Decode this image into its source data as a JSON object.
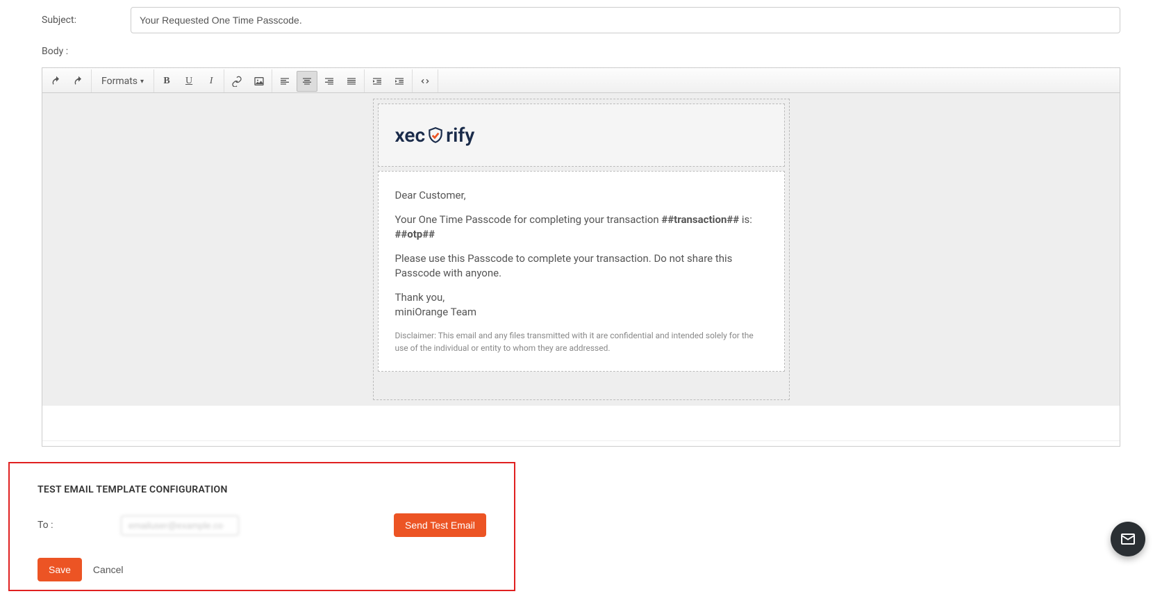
{
  "form": {
    "subject_label": "Subject:",
    "subject_value": "Your Requested One Time Passcode.",
    "body_label": "Body :"
  },
  "toolbar": {
    "formats_label": "Formats"
  },
  "email": {
    "logo_part1": "xec",
    "logo_part2": "rify",
    "greeting": "Dear Customer,",
    "line1_pre": "Your One Time Passcode for completing your transaction ",
    "line1_bold": "##transaction##",
    "line1_mid": " is: ",
    "line1_otp": "##otp##",
    "line2": "Please use this Passcode to complete your transaction. Do not share this Passcode with anyone.",
    "thankyou": "Thank you,",
    "team": "miniOrange Team",
    "disclaimer": "Disclaimer: This email and any files transmitted with it are confidential and intended solely for the use of the individual or entity to whom they are addressed."
  },
  "test": {
    "title": "TEST EMAIL TEMPLATE CONFIGURATION",
    "to_label": "To :",
    "to_value": "emailuser@example.co",
    "send_label": "Send Test Email"
  },
  "actions": {
    "save_label": "Save",
    "cancel_label": "Cancel"
  }
}
